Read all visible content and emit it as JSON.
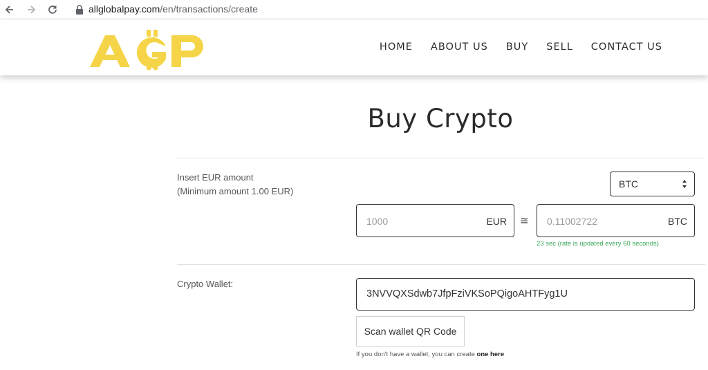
{
  "browser": {
    "url_host": "allglobalpay.com",
    "url_path": "/en/transactions/create"
  },
  "header": {
    "logo_text": "AGP",
    "nav": [
      {
        "label": "HOME"
      },
      {
        "label": "ABOUT US"
      },
      {
        "label": "BUY"
      },
      {
        "label": "SELL"
      },
      {
        "label": "CONTACT US"
      }
    ]
  },
  "page": {
    "title": "Buy Crypto"
  },
  "amount_section": {
    "label_line1": "Insert EUR amount",
    "label_line2": "(Minimum amount 1.00 EUR)",
    "currency_select": "BTC",
    "eur_value": "1000",
    "eur_unit": "EUR",
    "approx_symbol": "≅",
    "btc_value": "0.11002722",
    "btc_unit": "BTC",
    "rate_note": "23 sec (rate is updated every 60 seconds)"
  },
  "wallet_section": {
    "label": "Crypto Wallet:",
    "address": "3NVVQXSdwb7JfpFziVKSoPQigoAHTFyg1U",
    "scan_button": "Scan wallet QR Code",
    "hint_prefix": "If you don't have a wallet, you can create ",
    "hint_link": "one here"
  },
  "colors": {
    "logo_yellow": "#F5D547",
    "rate_green": "#3AA859"
  },
  "icons": [
    "back-arrow-icon",
    "forward-arrow-icon",
    "reload-icon",
    "lock-icon",
    "select-arrows-icon"
  ]
}
